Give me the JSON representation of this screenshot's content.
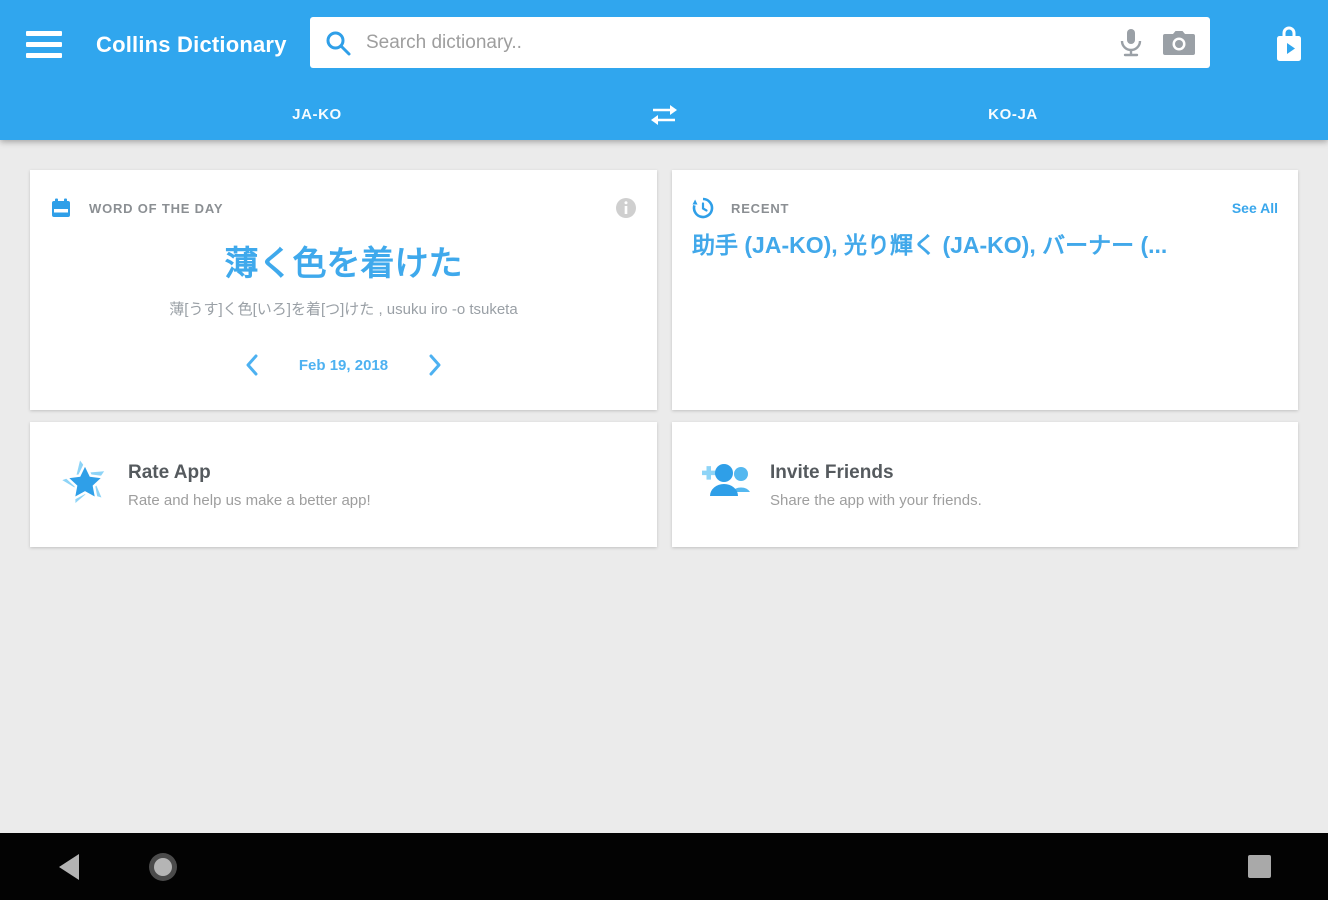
{
  "colors": {
    "header_blue": "#30a6ee",
    "accent_blue": "#3aa7ec",
    "word_blue": "#3fa9ec",
    "date_blue": "#4db1f1",
    "bg_gray": "#ebebeb",
    "label_gray": "#8b8f93",
    "subtitle_gray": "#9e9e9e",
    "nav_black": "#030303"
  },
  "header": {
    "title": "Collins Dictionary",
    "search": {
      "placeholder": "Search dictionary.."
    },
    "tabs": {
      "left": "JA-KO",
      "right": "KO-JA"
    }
  },
  "icons": {
    "menu": "hamburger",
    "search": "magnifier",
    "microphone": "mic",
    "camera": "camera",
    "store": "play-store-bag",
    "swap": "swap-arrows",
    "calendar": "calendar",
    "info": "info-circle",
    "history": "history-clock",
    "star": "double-star",
    "group_add": "group-add",
    "back": "triangle-left",
    "home": "circle",
    "recents": "square"
  },
  "word_of_the_day": {
    "label": "WORD OF THE DAY",
    "word": "薄く色を着けた",
    "reading": "薄[うす]く色[いろ]を着[つ]けた , usuku iro -o tsuketa",
    "date": "Feb 19, 2018"
  },
  "recent": {
    "label": "RECENT",
    "see_all": "See All",
    "items": "助手 (JA-KO), 光り輝く (JA-KO), バーナー (..."
  },
  "rate_app": {
    "title": "Rate App",
    "subtitle": "Rate and help us make a better app!"
  },
  "invite_friends": {
    "title": "Invite Friends",
    "subtitle": "Share the app with your friends."
  }
}
